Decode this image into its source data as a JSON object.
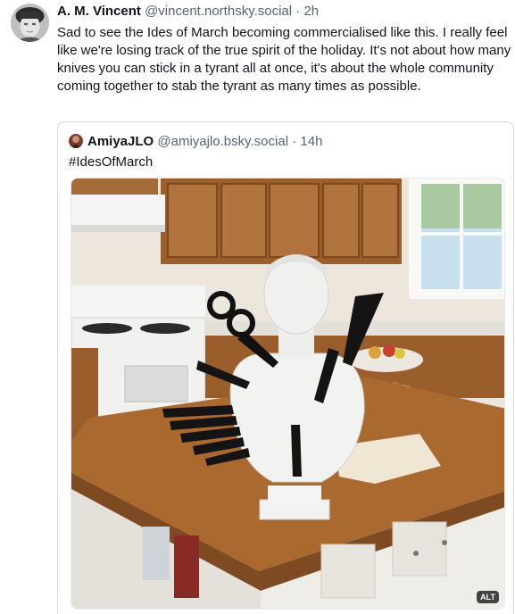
{
  "post": {
    "author": {
      "display_name": "A. M. Vincent",
      "handle": "@vincent.northsky.social",
      "separator": "·",
      "time": "2h"
    },
    "text": "Sad to see the Ides of March becoming commercialised like this. I really feel like we're losing track of the true spirit of the holiday. It's not about how many knives you can stick in a tyrant all at once, it's about the whole community coming together to stab the tyrant as many times as possible."
  },
  "quote": {
    "author": {
      "display_name": "AmiyaJLO",
      "handle": "@amiyajlo.bsky.social",
      "separator": "·",
      "time": "14h"
    },
    "text": "#IdesOfMarch",
    "media": {
      "alt_badge": "ALT"
    }
  }
}
